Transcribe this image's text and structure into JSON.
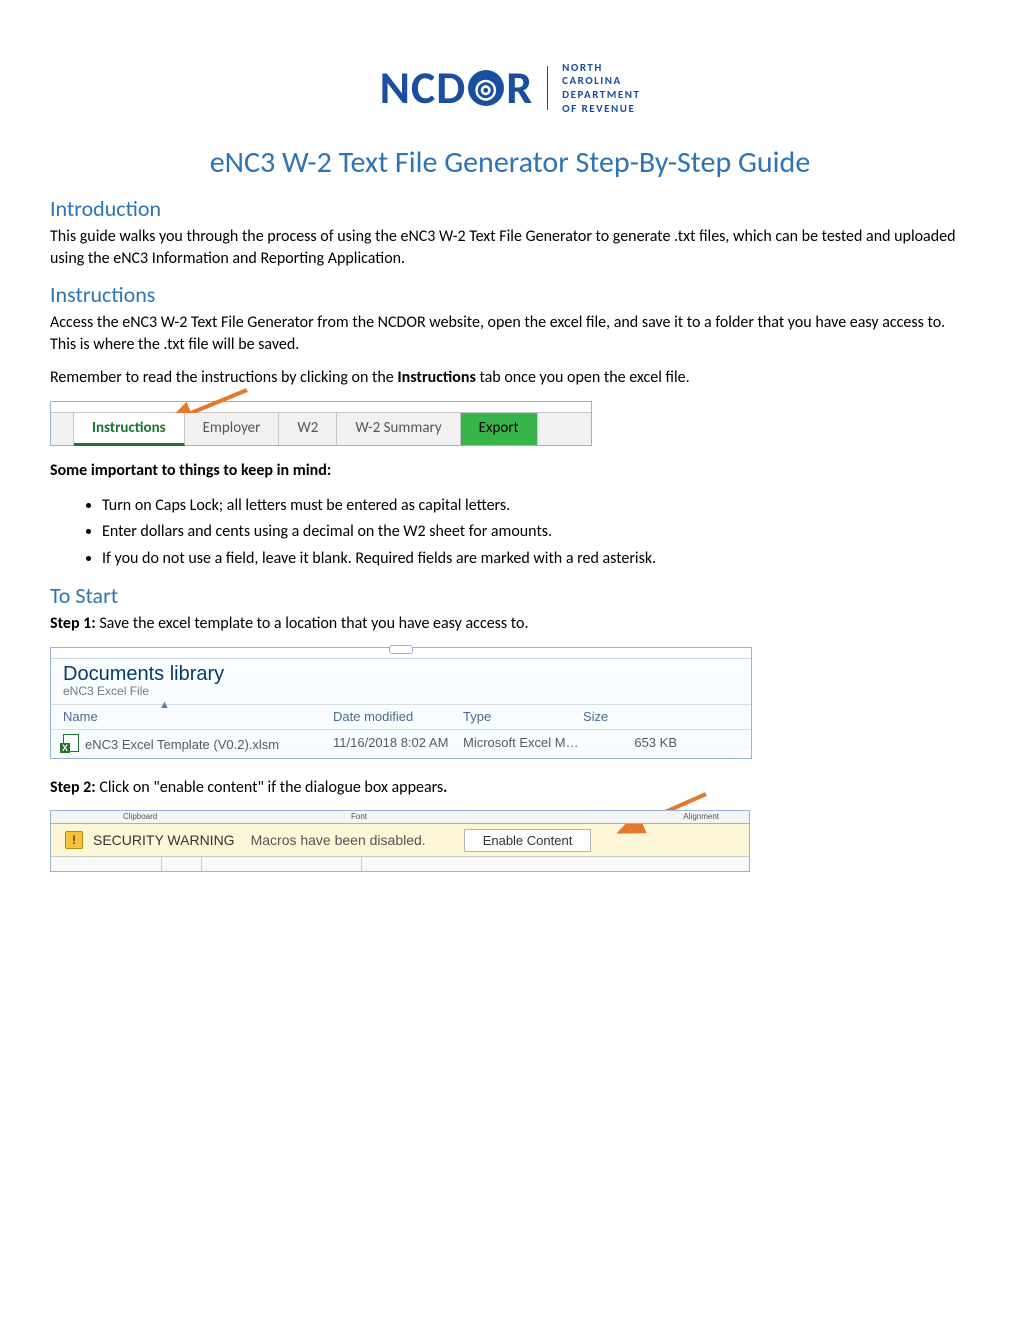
{
  "logo": {
    "brand": "NCDOR",
    "tag_line1": "NORTH",
    "tag_line2": "CAROLINA",
    "tag_line3": "DEPARTMENT",
    "tag_line4": "OF REVENUE"
  },
  "title": "eNC3 W-2 Text File Generator Step-By-Step Guide",
  "introduction": {
    "heading": "Introduction",
    "body": "This guide walks you through the process of using the eNC3 W-2 Text File Generator to generate .txt files, which can be tested and uploaded using the eNC3 Information and Reporting Application."
  },
  "instructions": {
    "heading": "Instructions",
    "p1_a": "Access the eNC3 W-2 Text File Generator from the NCDOR website, open the excel file, and save it to a folder that you have easy access to. This is where the .txt file will be saved.",
    "p2_pre": "Remember to read the instructions by clicking on the ",
    "p2_bold": "Instructions",
    "p2_post": " tab once you open the excel file.",
    "tabs": {
      "instructions": "Instructions",
      "employer": "Employer",
      "w2": "W2",
      "w2summary": "W-2 Summary",
      "export": "Export"
    },
    "keep_in_mind_heading": "Some important to things to keep in mind:",
    "bullets": [
      "Turn on Caps Lock; all letters must be entered as capital letters.",
      "Enter dollars and cents using a decimal on the W2 sheet for amounts.",
      "If you do not use a field, leave it blank. Required fields are marked with a red asterisk."
    ]
  },
  "to_start": {
    "heading": "To Start",
    "step1_label": "Step 1:",
    "step1_text": " Save the excel template to a location that you have easy access to.",
    "library": {
      "title": "Documents library",
      "subtitle": "eNC3 Excel File",
      "cols": {
        "name": "Name",
        "date": "Date modified",
        "type": "Type",
        "size": "Size"
      },
      "row": {
        "name": "eNC3 Excel Template (V0.2).xlsm",
        "date": "11/16/2018 8:02 AM",
        "type": "Microsoft Excel M…",
        "size": "653 KB"
      }
    },
    "step2_label": "Step 2:",
    "step2_text": " Click on \"enable content\" if the dialogue box appears",
    "step2_period": ".",
    "security": {
      "ribbon_clip": "Clipboard",
      "ribbon_font": "Font",
      "ribbon_align": "Alignment",
      "label": "SECURITY WARNING",
      "msg": "Macros have been disabled.",
      "button": "Enable Content"
    }
  }
}
